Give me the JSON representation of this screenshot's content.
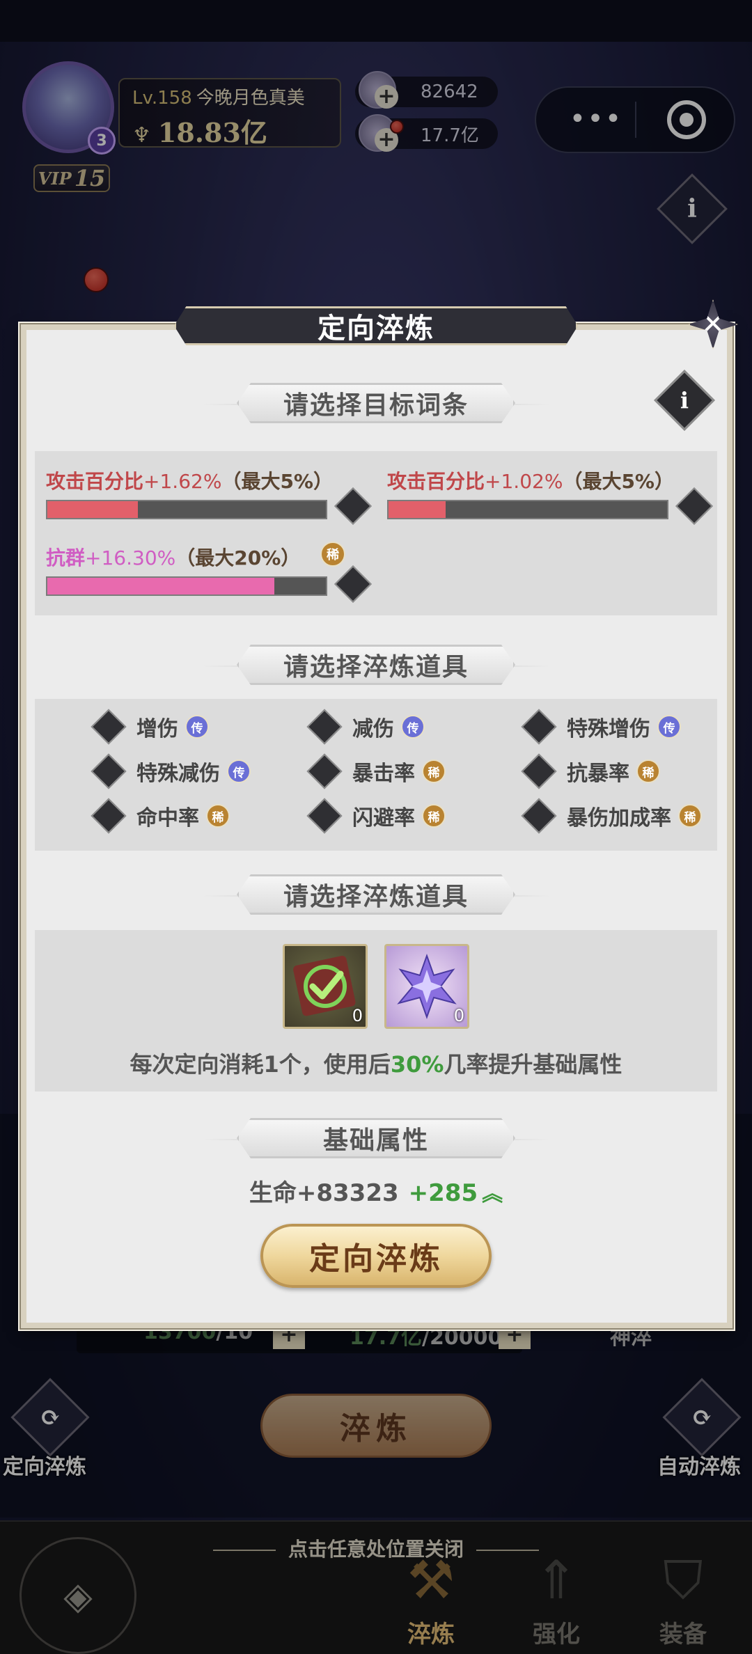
{
  "player": {
    "level_prefix": "Lv.",
    "level": "158",
    "name": "今晚月色真美",
    "power": "18.83亿",
    "avatar_badge": "3",
    "vip_label": "VIP",
    "vip_level": "15"
  },
  "resources": [
    {
      "icon": "crystal-icon",
      "value": "82642"
    },
    {
      "icon": "coin-icon",
      "value": "17.7亿"
    }
  ],
  "capsule": {
    "more": "•••"
  },
  "background": {
    "info_icon": "i",
    "left_button_label": "定向淬炼",
    "right_button_label": "自动淬炼",
    "refine_button": "淬炼",
    "counter1_value": "13700",
    "counter1_total": "/10",
    "counter2_value": "17.7亿",
    "counter2_total": "/20000",
    "right_text": "神淬",
    "plus": "+"
  },
  "modal": {
    "title": "定向淬炼",
    "close_icon": "✕",
    "info_icon": "i",
    "section1_title": "请选择目标词条",
    "stats": [
      {
        "name": "攻击百分比",
        "value": "+1.62%",
        "max": "（最大5%）",
        "progress": 0.324,
        "color": "#c0474a",
        "fill": "#e2606a",
        "badge": ""
      },
      {
        "name": "攻击百分比",
        "value": "+1.02%",
        "max": "（最大5%）",
        "progress": 0.204,
        "color": "#c0474a",
        "fill": "#e2606a",
        "badge": ""
      },
      {
        "name": "抗群",
        "value": "+16.30%",
        "max": "（最大20%）",
        "progress": 0.815,
        "color": "#d05dc3",
        "fill": "#e86aae",
        "badge": "稀"
      }
    ],
    "section2_title": "请选择淬炼道具",
    "options": [
      {
        "label": "增伤",
        "badge": "传",
        "type": "legend"
      },
      {
        "label": "减伤",
        "badge": "传",
        "type": "legend"
      },
      {
        "label": "特殊增伤",
        "badge": "传",
        "type": "legend"
      },
      {
        "label": "特殊减伤",
        "badge": "传",
        "type": "legend"
      },
      {
        "label": "暴击率",
        "badge": "稀",
        "type": "rare"
      },
      {
        "label": "抗暴率",
        "badge": "稀",
        "type": "rare"
      },
      {
        "label": "命中率",
        "badge": "稀",
        "type": "rare"
      },
      {
        "label": "闪避率",
        "badge": "稀",
        "type": "rare"
      },
      {
        "label": "暴伤加成率",
        "badge": "稀",
        "type": "rare"
      }
    ],
    "section3_title": "请选择淬炼道具",
    "items": [
      {
        "icon": "green-check-scroll-icon",
        "count": "0"
      },
      {
        "icon": "purple-crystal-icon",
        "count": "0"
      }
    ],
    "desc_before": "每次定向消耗1个，使用后",
    "desc_highlight": "30%",
    "desc_after": "几率提升基础属性",
    "section4_title": "基础属性",
    "base_stat": "生命+83323",
    "base_gain": "+285",
    "up_icon": "︽",
    "button": "定向淬炼"
  },
  "bottom": {
    "hint": "点击任意处位置关闭",
    "back_icon": "◈",
    "nav": [
      {
        "label": "淬炼",
        "icon": "anvil-icon",
        "glyph": "⚒"
      },
      {
        "label": "强化",
        "icon": "upgrade-icon",
        "glyph": "⇑"
      },
      {
        "label": "装备",
        "icon": "armor-icon",
        "glyph": "⛉"
      }
    ]
  },
  "colors": {
    "legend_badge": "#6a6fd6",
    "rare_badge": "#b98331",
    "highlight_green": "#3f9b3d"
  }
}
